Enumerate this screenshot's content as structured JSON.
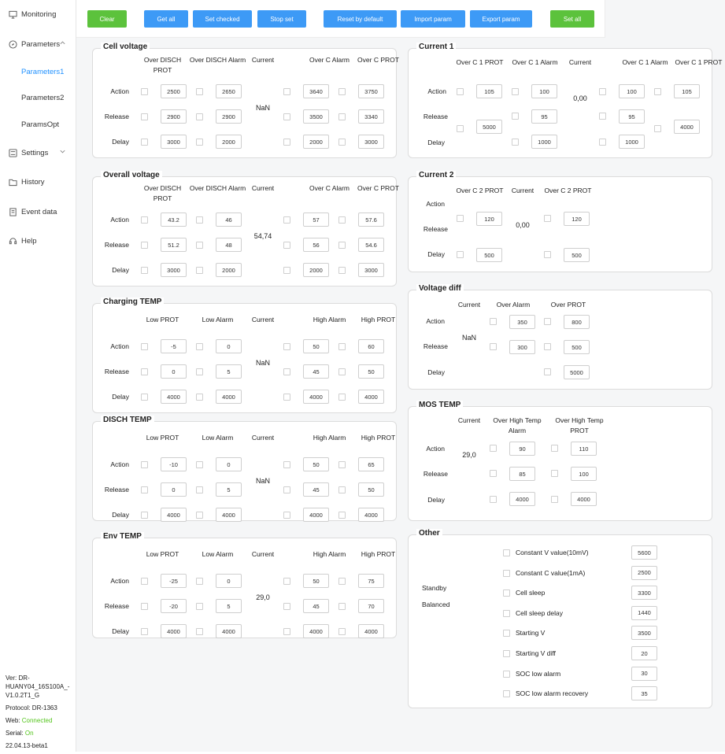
{
  "sidebar": {
    "items": [
      {
        "label": "Monitoring",
        "icon": "monitor-icon"
      },
      {
        "label": "Parameters",
        "icon": "compass-icon"
      },
      {
        "label": "Parameters1",
        "sub": true,
        "active": true
      },
      {
        "label": "Parameters2",
        "sub": true
      },
      {
        "label": "ParamsOpt",
        "sub": true
      },
      {
        "label": "Settings",
        "icon": "settings-icon"
      },
      {
        "label": "History",
        "icon": "folder-icon"
      },
      {
        "label": "Event data",
        "icon": "document-icon"
      },
      {
        "label": "Help",
        "icon": "headset-icon"
      }
    ],
    "info": {
      "ver": "Ver: DR-HUANY04_16S100A_-V1.0.2T1_G",
      "protocol": "Protocol: DR-1363",
      "web_label": "Web: ",
      "web_value": "Connected",
      "serial_label": "Serial: ",
      "serial_value": "On",
      "build": "22.04.13-beta1"
    },
    "accent": "#1e90ff"
  },
  "toolbar": {
    "buttons": [
      {
        "label": "Clear",
        "color": "green"
      },
      {
        "label": "Get all",
        "color": "blue"
      },
      {
        "label": "Set checked",
        "color": "blue"
      },
      {
        "label": "Stop set",
        "color": "blue"
      },
      {
        "label": "Reset by default",
        "color": "blue"
      },
      {
        "label": "Import param",
        "color": "blue"
      },
      {
        "label": "Export param",
        "color": "blue"
      },
      {
        "label": "Set all",
        "color": "green"
      }
    ]
  },
  "labels": {
    "action": "Action",
    "release": "Release",
    "delay": "Delay",
    "current": "Current"
  },
  "sections": {
    "cell_voltage": {
      "title": "Cell voltage",
      "headers": [
        "Over DISCH PROT",
        "Over DISCH Alarm",
        "Over C Alarm",
        "Over C PROT"
      ],
      "current": "NaN",
      "values": [
        [
          "2500",
          "2650",
          "3640",
          "3750"
        ],
        [
          "2900",
          "2900",
          "3500",
          "3340"
        ],
        [
          "3000",
          "2000",
          "2000",
          "3000"
        ]
      ]
    },
    "overall_voltage": {
      "title": "Overall voltage",
      "headers": [
        "Over DISCH PROT",
        "Over DISCH Alarm",
        "Over C Alarm",
        "Over C PROT"
      ],
      "current": "54,74",
      "values": [
        [
          "43.2",
          "46",
          "57",
          "57.6"
        ],
        [
          "51.2",
          "48",
          "56",
          "54.6"
        ],
        [
          "3000",
          "2000",
          "2000",
          "3000"
        ]
      ]
    },
    "charging_temp": {
      "title": "Charging TEMP",
      "headers": [
        "Low PROT",
        "Low Alarm",
        "High Alarm",
        "High PROT"
      ],
      "current": "NaN",
      "values": [
        [
          "-5",
          "0",
          "50",
          "60"
        ],
        [
          "0",
          "5",
          "45",
          "50"
        ],
        [
          "4000",
          "4000",
          "4000",
          "4000"
        ]
      ]
    },
    "disch_temp": {
      "title": "DISCH TEMP",
      "headers": [
        "Low PROT",
        "Low Alarm",
        "High Alarm",
        "High PROT"
      ],
      "current": "NaN",
      "values": [
        [
          "-10",
          "0",
          "50",
          "65"
        ],
        [
          "0",
          "5",
          "45",
          "50"
        ],
        [
          "4000",
          "4000",
          "4000",
          "4000"
        ]
      ]
    },
    "env_temp": {
      "title": "Env TEMP",
      "headers": [
        "Low PROT",
        "Low Alarm",
        "High Alarm",
        "High PROT"
      ],
      "current": "29,0",
      "values": [
        [
          "-25",
          "0",
          "50",
          "75"
        ],
        [
          "-20",
          "5",
          "45",
          "70"
        ],
        [
          "4000",
          "4000",
          "4000",
          "4000"
        ]
      ]
    },
    "current1": {
      "title": "Current 1",
      "headers": [
        "Over C 1 PROT",
        "Over C 1 Alarm",
        "Over C 1 Alarm",
        "Over C 1 PROT"
      ],
      "current": "0,00",
      "action": [
        "105",
        "100",
        "100",
        "105"
      ],
      "release": [
        "95",
        "95"
      ],
      "delay": [
        "5000",
        "1000",
        "1000",
        "4000"
      ]
    },
    "current2": {
      "title": "Current 2",
      "headers": [
        "Over C 2 PROT",
        "Over C 2 PROT"
      ],
      "current": "0,00",
      "action": [
        "120",
        "120"
      ],
      "delay": [
        "500",
        "500"
      ]
    },
    "voltage_diff": {
      "title": "Voltage diff",
      "headers": [
        "Over Alarm",
        "Over PROT"
      ],
      "current": "NaN",
      "action": [
        "350",
        "800"
      ],
      "release": [
        "300",
        "500"
      ],
      "delay": [
        "5000"
      ]
    },
    "mos_temp": {
      "title": "MOS TEMP",
      "headers": [
        "Over High Temp Alarm",
        "Over High Temp PROT"
      ],
      "current": "29,0",
      "values": [
        [
          "90",
          "110"
        ],
        [
          "85",
          "100"
        ],
        [
          "4000",
          "4000"
        ]
      ]
    },
    "other": {
      "title": "Other",
      "left1": "Standby",
      "left2": "Balanced",
      "items": [
        {
          "label": "Constant V value(10mV)",
          "value": "5600"
        },
        {
          "label": "Constant C value(1mA)",
          "value": "2500"
        },
        {
          "label": "Cell sleep",
          "value": "3300"
        },
        {
          "label": "Cell sleep delay",
          "value": "1440"
        },
        {
          "label": "Starting V",
          "value": "3500"
        },
        {
          "label": "Starting V diff",
          "value": "20"
        },
        {
          "label": "SOC low alarm",
          "value": "30"
        },
        {
          "label": "SOC low alarm recovery",
          "value": "35"
        }
      ]
    }
  }
}
